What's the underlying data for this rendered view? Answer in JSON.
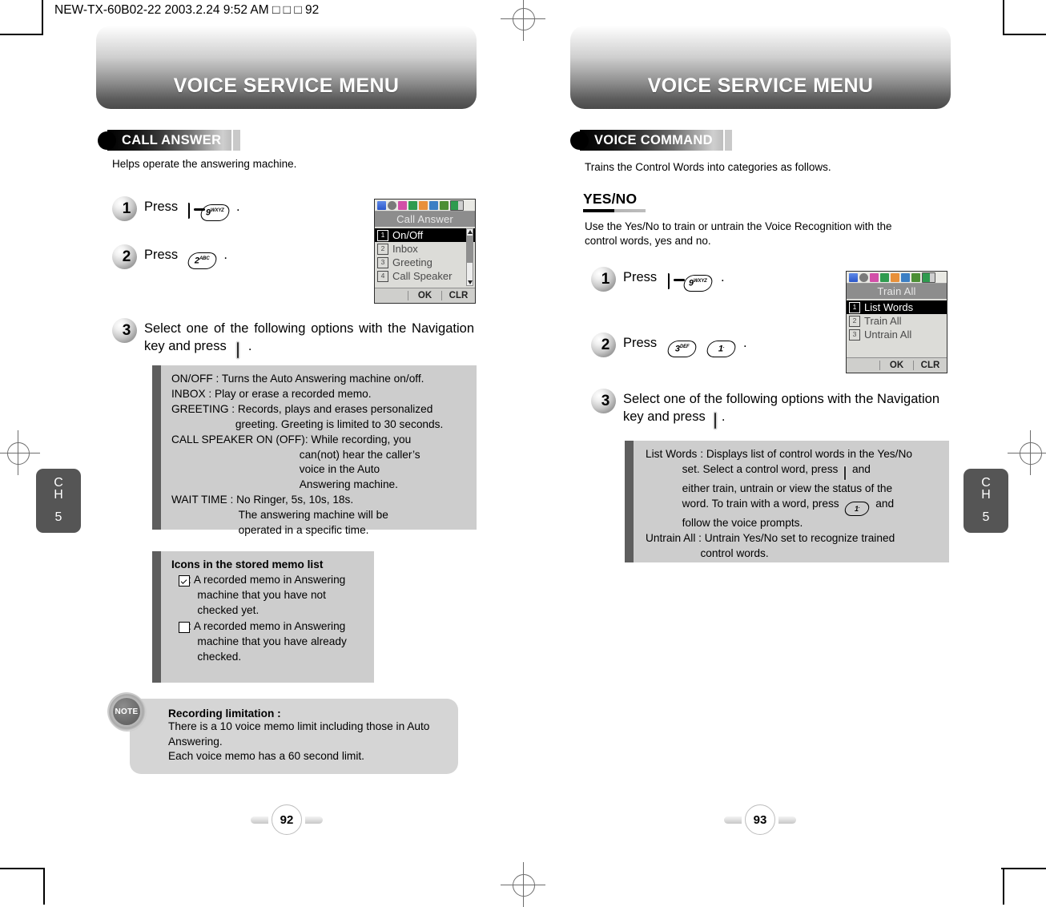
{
  "file_header": "NEW-TX-60B02-22  2003.2.24 9:52 AM  □ □ □ 92",
  "left_page": {
    "banner_title": "VOICE SERVICE MENU",
    "section_tag": "CALL ANSWER",
    "lede": "Helps operate the answering machine.",
    "steps": [
      {
        "num": "1",
        "text_before": "Press",
        "text_after": "."
      },
      {
        "num": "2",
        "text_before": "Press",
        "text_after": "."
      },
      {
        "num": "3",
        "text": "Select one of the following options with the Navigation key and press",
        "text_after": "."
      }
    ],
    "keys": {
      "send": "send-key",
      "nine": "9",
      "nine_sub": "WXYZ",
      "two": "2",
      "two_sub": "ABC",
      "ok": "ok-key"
    },
    "options_box": "ON/OFF : Turns the Auto Answering machine on/off.\nINBOX : Play or erase a recorded memo.\nGREETING : Records, plays and erases personalized\n                     greeting. Greeting is limited to 30 seconds.\nCALL SPEAKER ON (OFF): While recording, you\n                                          can(not) hear the caller’s\n                                          voice in the Auto\n                                          Answering machine.\nWAIT TIME : No Ringer, 5s, 10s, 18s.\n                      The answering machine will be\n                      operated in a specific time.",
    "icons_box": {
      "heading": "Icons in the stored memo list",
      "item1": ": A recorded memo in Answering\n   machine that you have not\n   checked yet.",
      "item2": ": A recorded memo in Answering\n   machine that you have already\n   checked."
    },
    "note": {
      "badge": "NOTE",
      "heading": "Recording limitation :",
      "body": "There is a 10 voice memo limit including those in Auto\nAnswering.\nEach voice memo has a 60 second limit."
    },
    "lcd": {
      "title": "Call Answer",
      "rows": [
        {
          "n": "1",
          "label": "On/Off",
          "selected": true
        },
        {
          "n": "2",
          "label": "Inbox",
          "selected": false
        },
        {
          "n": "3",
          "label": "Greeting",
          "selected": false
        },
        {
          "n": "4",
          "label": "Call Speaker",
          "selected": false
        }
      ],
      "soft_left": "",
      "soft_ok": "OK",
      "soft_clr": "CLR"
    },
    "chapter_tab": {
      "ch": "C\nH",
      "num": "5"
    },
    "page_number": "92"
  },
  "right_page": {
    "banner_title": "VOICE SERVICE MENU",
    "section_tag": "VOICE COMMAND",
    "lede": "Trains the Control Words into categories as follows.",
    "subhead": "YES/NO",
    "subhead_body": "Use the Yes/No to train or untrain the Voice Recognition with the\ncontrol words, yes and no.",
    "steps": [
      {
        "num": "1",
        "text_before": "Press",
        "text_after": "."
      },
      {
        "num": "2",
        "text_before": "Press",
        "text_after": "."
      },
      {
        "num": "3",
        "text": "Select one of the following options with the Navigation key and press",
        "text_after": "."
      }
    ],
    "keys": {
      "send": "send-key",
      "nine": "9",
      "nine_sub": "WXYZ",
      "three": "3",
      "three_sub": "DEF",
      "one": "1",
      "ok": "ok-key"
    },
    "options_box_1_label": "List Words : ",
    "options_box_1a": "Displays list of control words in the Yes/No",
    "options_box_1b": "            set. Select a control word, press",
    "options_box_1c": "and",
    "options_box_1d": "            either train, untrain or view the status of the",
    "options_box_1e": "            word. To train with a word, press",
    "options_box_1f": "and",
    "options_box_1g": "            follow the voice prompts.",
    "options_box_2": "Untrain All : Untrain Yes/No set to recognize trained\n                  control words.",
    "lcd": {
      "title": "Train All",
      "rows": [
        {
          "n": "1",
          "label": "List Words",
          "selected": true
        },
        {
          "n": "2",
          "label": "Train All",
          "selected": false
        },
        {
          "n": "3",
          "label": "Untrain All",
          "selected": false
        }
      ],
      "soft_left": "",
      "soft_ok": "OK",
      "soft_clr": "CLR"
    },
    "chapter_tab": {
      "ch": "C\nH",
      "num": "5"
    },
    "page_number": "93"
  },
  "colors": {
    "box_gray": "#cdcdcd",
    "box_bar": "#5e5e5e",
    "tab_gray": "#555555",
    "note_gray": "#d5d5d5"
  }
}
